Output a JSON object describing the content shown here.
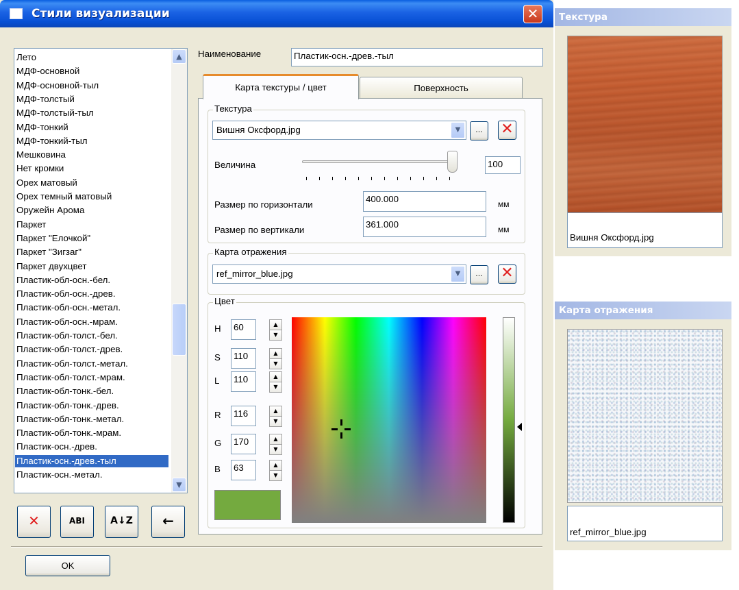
{
  "dialog": {
    "title": "Стили визуализации",
    "close_label": "✕"
  },
  "styles_list": {
    "items": [
      "Лето",
      "МДФ-основной",
      "МДФ-основной-тыл",
      "МДФ-толстый",
      "МДФ-толстый-тыл",
      "МДФ-тонкий",
      "МДФ-тонкий-тыл",
      "Мешковина",
      "Нет кромки",
      "Орех матовый",
      "Орех темный матовый",
      "Оружейн Арома",
      "Паркет",
      "Паркет \"Елочкой\"",
      "Паркет \"Зигзаг\"",
      "Паркет двухцвет",
      "Пластик-обл-осн.-бел.",
      "Пластик-обл-осн.-древ.",
      "Пластик-обл-осн.-метал.",
      "Пластик-обл-осн.-мрам.",
      "Пластик-обл-толст.-бел.",
      "Пластик-обл-толст.-древ.",
      "Пластик-обл-толст.-метал.",
      "Пластик-обл-толст.-мрам.",
      "Пластик-обл-тонк.-бел.",
      "Пластик-обл-тонк.-древ.",
      "Пластик-обл-тонк.-метал.",
      "Пластик-обл-тонк.-мрам.",
      "Пластик-осн.-древ.",
      "Пластик-осн.-древ.-тыл",
      "Пластик-осн.-метал."
    ],
    "selected": "Пластик-осн.-древ.-тыл"
  },
  "list_buttons": {
    "delete_icon": "red-x-icon",
    "rename_icon": "rename-abi-icon",
    "rename_glyph": "ABI",
    "sort_icon": "sort-az-icon",
    "sort_glyph": "A↓Z",
    "back_icon": "arrow-left-icon",
    "back_glyph": "←",
    "delete_glyph": "✕"
  },
  "ok_button": "OK",
  "name": {
    "label": "Наименование",
    "value": "Пластик-осн.-древ.-тыл"
  },
  "tabs": [
    {
      "label": "Карта текстуры / цвет",
      "active": true
    },
    {
      "label": "Поверхность",
      "active": false
    }
  ],
  "texture_group": {
    "legend": "Текстура",
    "file": "Вишня Оксфорд.jpg",
    "browse_label": "...",
    "magnitude_label": "Величина",
    "magnitude_value": "100",
    "slider_level_percent": 100,
    "h_size_label": "Размер по горизонтали",
    "h_size_value": "400.000",
    "v_size_label": "Размер по вертикали",
    "v_size_value": "361.000",
    "unit": "мм"
  },
  "reflection_group": {
    "legend": "Карта отражения",
    "file": "ref_mirror_blue.jpg",
    "browse_label": "..."
  },
  "color_group": {
    "legend": "Цвет",
    "fields": [
      {
        "label": "H",
        "value": "60"
      },
      {
        "label": "S",
        "value": "110"
      },
      {
        "label": "L",
        "value": "110"
      },
      {
        "label": "R",
        "value": "116"
      },
      {
        "label": "G",
        "value": "170"
      },
      {
        "label": "B",
        "value": "63"
      }
    ],
    "swatch_color": "#74aa3f"
  },
  "texture_panel": {
    "title": "Текстура",
    "caption": "Вишня Оксфорд.jpg"
  },
  "reflection_panel": {
    "title": "Карта отражения",
    "caption": "ref_mirror_blue.jpg"
  },
  "colors": {
    "titlebar": "#0a5fe0",
    "dialog_bg": "#ece9d8",
    "selection": "#316ac5",
    "delete_red": "#e02020"
  }
}
